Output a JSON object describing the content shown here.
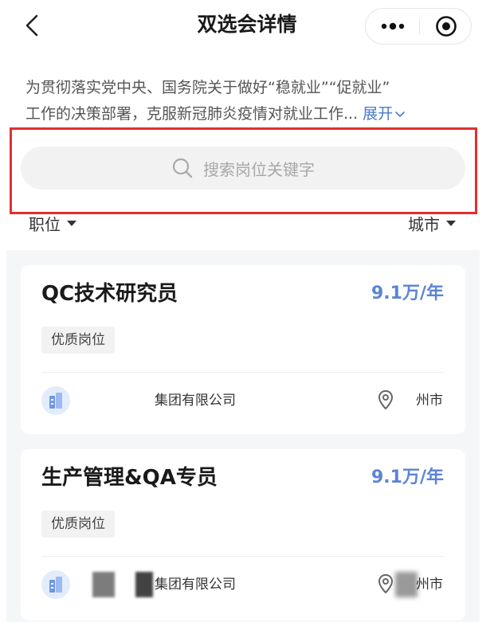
{
  "header": {
    "title": "双选会详情",
    "back_icon": "chevron-left-icon",
    "more_icon": "more-dots-icon",
    "close_icon": "target-circle-icon"
  },
  "intro": {
    "line1": "为贯彻落实党中央、国务院关于做好“稳就业”“促就业”",
    "line2": "工作的决策部署，克服新冠肺炎疫情对就业工作...",
    "expand_label": "展开"
  },
  "search": {
    "placeholder": "搜索岗位关键字",
    "icon": "search-icon"
  },
  "filters": {
    "position_label": "职位",
    "city_label": "城市"
  },
  "jobs": [
    {
      "title": "QC技术研究员",
      "salary": "9.1万/年",
      "tag": "优质岗位",
      "company": "集团有限公司",
      "city": "州市"
    },
    {
      "title": "生产管理&QA专员",
      "salary": "9.1万/年",
      "tag": "优质岗位",
      "company": "集团有限公司",
      "city": "州市"
    }
  ],
  "colors": {
    "accent": "#5b84d6",
    "link": "#4b7ad1",
    "highlight_border": "#e0302e"
  }
}
